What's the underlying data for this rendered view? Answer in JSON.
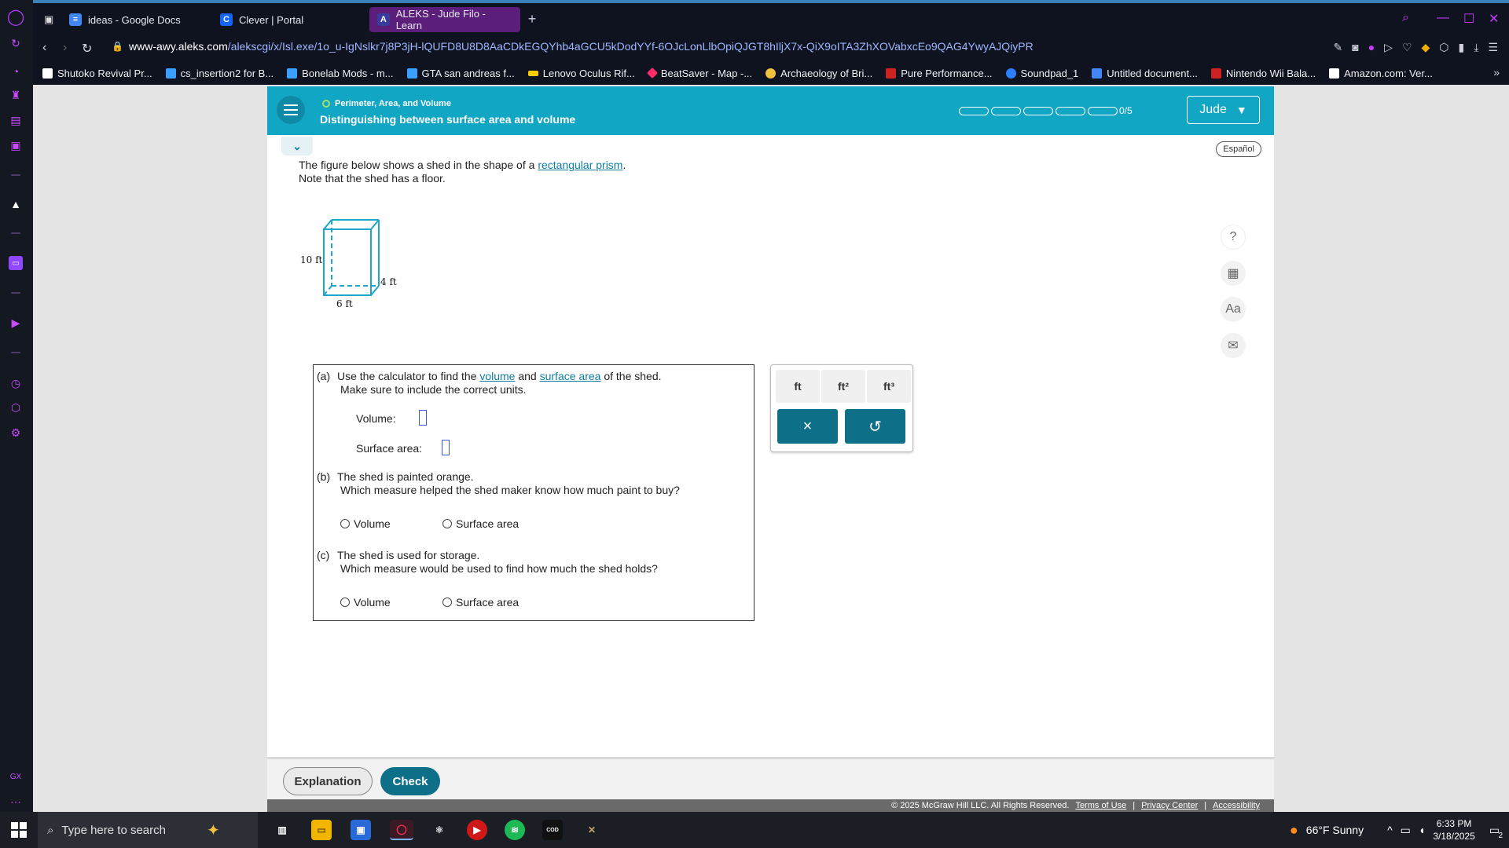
{
  "browser": {
    "tabs": [
      {
        "label": "ideas - Google Docs",
        "icon": "docs-icon",
        "color": "#4285f4"
      },
      {
        "label": "Clever | Portal",
        "icon": "clever-icon",
        "color": "#1464ff"
      },
      {
        "label": "ALEKS - Jude Filo - Learn",
        "icon": "aleks-icon",
        "color": "#3a3a9a",
        "active": true
      }
    ],
    "url_host": "www-awy.aleks.com",
    "url_path": "/alekscgi/x/Isl.exe/1o_u-IgNslkr7j8P3jH-lQUFD8U8D8AaCDkEGQYhb4aGCU5kDodYYf-6OJcLonLlbOpiQJGT8hIljX7x-QiX9oITA3ZhXOVabxcEo9QAG4YwyAJQiyPR",
    "bookmarks": [
      "Shutoko Revival Pr...",
      "cs_insertion2 for B...",
      "Bonelab Mods - m...",
      "GTA san andreas f...",
      "Lenovo Oculus Rif...",
      "BeatSaver - Map -...",
      "Archaeology of Bri...",
      "Pure Performance...",
      "Soundpad_1",
      "Untitled document...",
      "Nintendo Wii Bala...",
      "Amazon.com: Ver..."
    ],
    "bookmark_colors": [
      "#ffffff",
      "#3aa0ff",
      "#3aa0ff",
      "#3aa0ff",
      "#ffcc00",
      "#ff2b6a",
      "#f0c040",
      "#cc2222",
      "#2a7fff",
      "#4285f4",
      "#cc2222",
      "#ffffff"
    ]
  },
  "aleks": {
    "topic": "Perimeter, Area, and Volume",
    "lesson": "Distinguishing between surface area and volume",
    "progress": {
      "done": 0,
      "total": 5,
      "label": "0/5"
    },
    "user": "Jude",
    "espanol": "Español",
    "intro_pre": "The figure below shows a shed in the shape of a ",
    "intro_link": "rectangular prism",
    "intro_post": ".",
    "intro_line2": "Note that the shed has a floor.",
    "figure": {
      "height": "10 ft",
      "depth": "4 ft",
      "width": "6 ft"
    },
    "part_a": {
      "tag": "(a)",
      "pre": "Use the calculator to find the ",
      "link1": "volume",
      "mid": " and ",
      "link2": "surface area",
      "post": " of the shed.",
      "line2": "Make sure to include the correct units.",
      "volume_label": "Volume:",
      "surface_label": "Surface area:"
    },
    "part_b": {
      "tag": "(b)",
      "line1": "The shed is painted orange.",
      "line2": "Which measure helped the shed maker know how much paint to buy?",
      "opt1": "Volume",
      "opt2": "Surface area"
    },
    "part_c": {
      "tag": "(c)",
      "line1": "The shed is used for storage.",
      "line2": "Which measure would be used to find how much the shed holds?",
      "opt1": "Volume",
      "opt2": "Surface area"
    },
    "units": {
      "ft": "ft",
      "ft2": "ft²",
      "ft3": "ft³"
    },
    "buttons": {
      "clear": "×",
      "undo": "↺",
      "explanation": "Explanation",
      "check": "Check"
    },
    "footer": {
      "copyright": "© 2025 McGraw Hill LLC. All Rights Reserved.",
      "terms": "Terms of Use",
      "privacy": "Privacy Center",
      "accessibility": "Accessibility",
      "sep": "|"
    }
  },
  "taskbar": {
    "search_placeholder": "Type here to search",
    "weather": "66°F  Sunny",
    "time": "6:33 PM",
    "date": "3/18/2025",
    "notifications": "2"
  },
  "colors": {
    "aleks_teal": "#12a6c5",
    "button_teal": "#0d6f88",
    "link": "#0e7fa0",
    "opera_accent": "#c93bff"
  }
}
